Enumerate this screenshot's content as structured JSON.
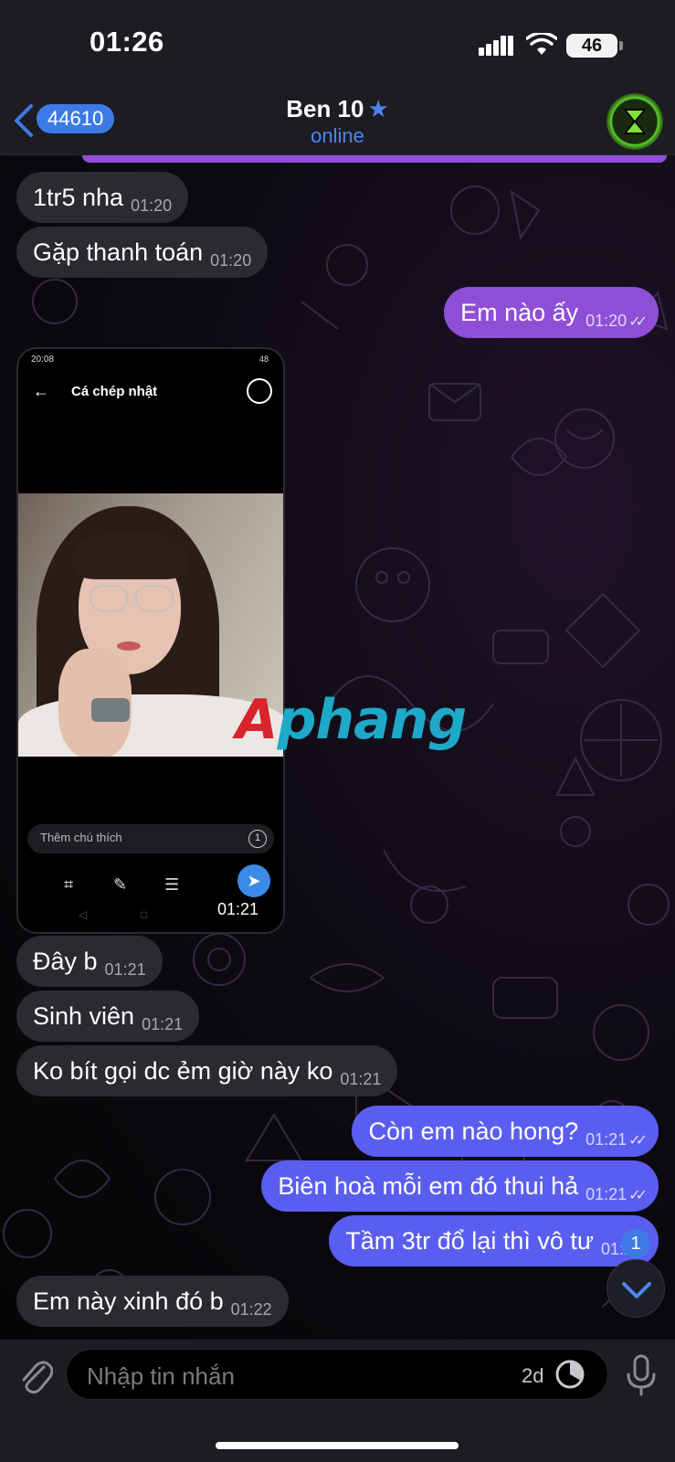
{
  "status_bar": {
    "time": "01:26",
    "battery": "46"
  },
  "header": {
    "back_count": "44610",
    "title": "Ben 10",
    "title_star": "★",
    "status": "online"
  },
  "messages": [
    {
      "dir": "in",
      "text": "1tr5 nha",
      "time": "01:20"
    },
    {
      "dir": "in",
      "text": "Gặp thanh toán",
      "time": "01:20"
    },
    {
      "dir": "out",
      "text": "Em nào ấy",
      "time": "01:20",
      "read": true
    },
    {
      "dir": "in",
      "text": "Đây b",
      "time": "01:21"
    },
    {
      "dir": "in",
      "text": "Sinh viên",
      "time": "01:21"
    },
    {
      "dir": "in",
      "text": "Ko bít gọi dc ẻm giờ này ko",
      "time": "01:21"
    },
    {
      "dir": "out",
      "text": "Còn em nào hong?",
      "time": "01:21",
      "read": true
    },
    {
      "dir": "out",
      "text": "Biên hoà mỗi em đó thui hả",
      "time": "01:21",
      "read": true
    },
    {
      "dir": "out",
      "text": "Tầm 3tr đổ lại thì vô tư",
      "time": "01:21"
    },
    {
      "dir": "in",
      "text": "Em này xinh đó b",
      "time": "01:22"
    }
  ],
  "image_message": {
    "inner_status_time": "20:08",
    "inner_status_right": "48",
    "inner_title": "Cá chép nhật",
    "caption_placeholder": "Thêm chú thích",
    "caption_icon": "1",
    "time": "01:21"
  },
  "watermark": {
    "part1": "A",
    "part2": "phang"
  },
  "scroll_badge": "1",
  "input": {
    "placeholder": "Nhập tin nhắn",
    "timer_label": "2d"
  },
  "colors": {
    "accent": "#3d7ae6",
    "out_bubble_purple": "#8e4fd6",
    "out_bubble_blue": "#5a5ef0",
    "in_bubble": "#2a2a30"
  }
}
